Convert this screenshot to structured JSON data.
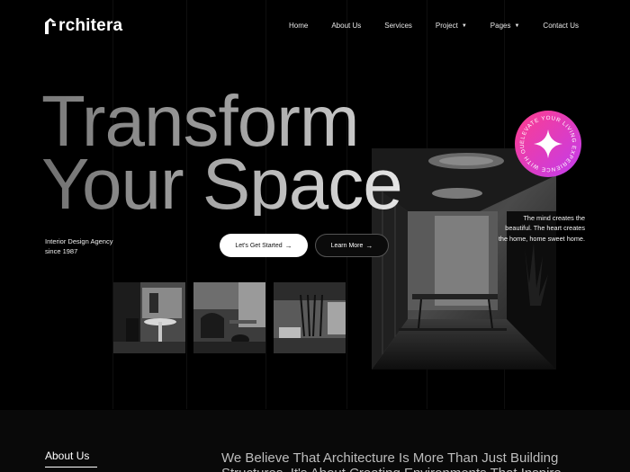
{
  "brand": {
    "logo_text": "rchitera"
  },
  "nav": {
    "items": [
      {
        "label": "Home",
        "dropdown": false
      },
      {
        "label": "About Us",
        "dropdown": false
      },
      {
        "label": "Services",
        "dropdown": false
      },
      {
        "label": "Project",
        "dropdown": true
      },
      {
        "label": "Pages",
        "dropdown": true
      },
      {
        "label": "Contact Us",
        "dropdown": false
      }
    ]
  },
  "hero": {
    "title_line1": "Transform",
    "title_line2": "Your Space",
    "tagline_line1": "Interior Design Agency",
    "tagline_line2": "since 1987",
    "primary_button": "Let's Get Started",
    "secondary_button": "Learn More",
    "quote_line1": "The mind creates the",
    "quote_line2": "beautiful.  The heart creates",
    "quote_line3": "the home, home sweet home.",
    "badge_text": "ELEVATE YOUR LIVING EXPERIENCE WITH OUR CLASS"
  },
  "about": {
    "label": "About Us",
    "text": "We Believe That Architecture Is More Than Just Building Structures. It's About Creating Environments That Inspire"
  },
  "colors": {
    "background": "#000000",
    "badge_gradient_start": "#ff3d8b",
    "badge_gradient_end": "#c13cf0",
    "primary_button_bg": "#ffffff"
  },
  "icons": {
    "arrow": "→",
    "caret": "▼"
  }
}
